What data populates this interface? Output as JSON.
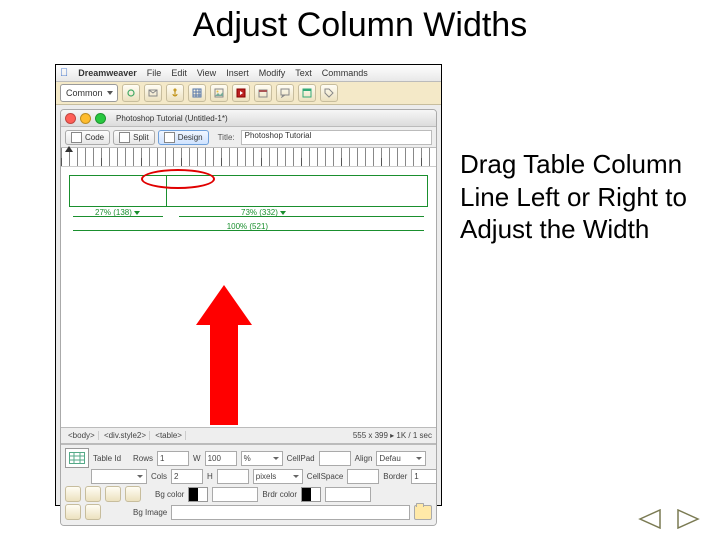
{
  "title": "Adjust Column Widths",
  "caption": "Drag Table Column Line Left or Right to Adjust the Width",
  "menubar": {
    "app_name": "Dreamweaver",
    "items": [
      "File",
      "Edit",
      "View",
      "Insert",
      "Modify",
      "Text",
      "Commands"
    ]
  },
  "insert_toolbar": {
    "category": "Common",
    "icons": [
      "hyperlink-icon",
      "email-icon",
      "anchor-icon",
      "table-icon",
      "image-icon",
      "media-icon",
      "date-icon",
      "comment-icon",
      "template-icon",
      "tag-icon"
    ]
  },
  "doc": {
    "title": "Photoshop Tutorial (Untitled-1*)",
    "view_tabs": {
      "code": "Code",
      "split": "Split",
      "design": "Design"
    },
    "title_label": "Title:",
    "title_value": "Photoshop Tutorial"
  },
  "table_overlay": {
    "col1_label": "27% (138)",
    "col2_label": "73% (332)",
    "full_label": "100% (521)"
  },
  "status": {
    "tags": [
      "<body>",
      "<div.style2>",
      "<table>"
    ],
    "dims": "555 x 399",
    "kbsec": "1K / 1 sec"
  },
  "properties": {
    "section": "Table Id",
    "rows_label": "Rows",
    "rows_value": "1",
    "cols_label": "Cols",
    "cols_value": "2",
    "w_label": "W",
    "w_value": "100",
    "w_unit": "%",
    "h_label": "H",
    "h_value": "",
    "h_unit": "pixels",
    "cellpad_label": "CellPad",
    "cellpad_value": "",
    "cellspace_label": "CellSpace",
    "cellspace_value": "",
    "align_label": "Align",
    "align_value": "Defau",
    "border_label": "Border",
    "border_value": "1",
    "bgcolor_label": "Bg color",
    "brdrcolor_label": "Brdr color",
    "bgimage_label": "Bg Image"
  }
}
